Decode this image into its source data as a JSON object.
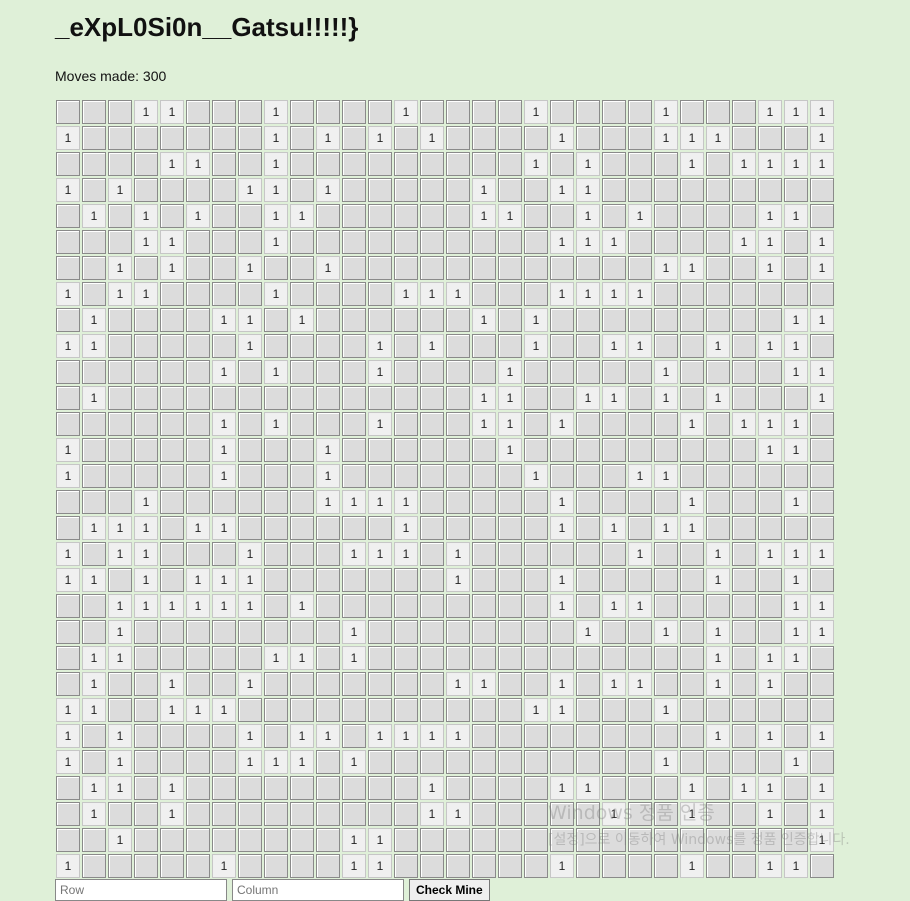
{
  "page": {
    "title": "_eXpL0Si0n__Gatsu!!!!!}",
    "moves_label": "Moves made: 300"
  },
  "board": {
    "rows": 30,
    "cols": 30,
    "hidden_color": "#dcdcdc",
    "open_color": "#f0f0f0",
    "grid": [
      "---11---1----1----1----1---111",
      "1-------1-1-1-1----1---111---1",
      "----11--1---------1-1---1-1111",
      "1-1----11-1-----1--11---------",
      "-1-1-1--11------11--1-1----11-",
      "---11---1----------111----11-1",
      "--1-1--1--1------------11--1-1",
      "1-11----1----111---1111-------",
      "-1----11-1------1-1---------11",
      "11-----1----1-1---1--11--1-11-",
      "------1-1---1----1-----1----11",
      "-1--------------11--11-1-1---1",
      "------1-1---1---11-1----1-111-",
      "1-----1---1------1---------11-",
      "1-----1---1-------1---11------",
      "---1------1111-----1----1---1-",
      "-111-11------1-----1-1-11-----",
      "1-11---1---111-1------1--1-11111",
      "11-1-111-------1---1-----1--1-1",
      "--111111-1---------1-11-----11",
      "--1--------1--------1--1-1--111",
      "-11-----11-1-------------1-11-",
      "-1--1--1-------11--1-11--1-1--",
      "11--111-----------11---1------",
      "1-1----1-11-1111---------1-1-1",
      "1-1----111-1-----------1----1-",
      "-11-1---------1----11---1-11-11",
      "-1--1---------11-----1--1--1-1",
      "--1--------11----------------1",
      "1-----1----11------1----1--11-"
    ]
  },
  "controls": {
    "row_placeholder": "Row",
    "column_placeholder": "Column",
    "check_label": "Check Mine"
  },
  "watermark": {
    "line1": "Windows 정품 인증",
    "line2": "[설정]으로 이동하여 Windows를 정품 인증합니다."
  }
}
